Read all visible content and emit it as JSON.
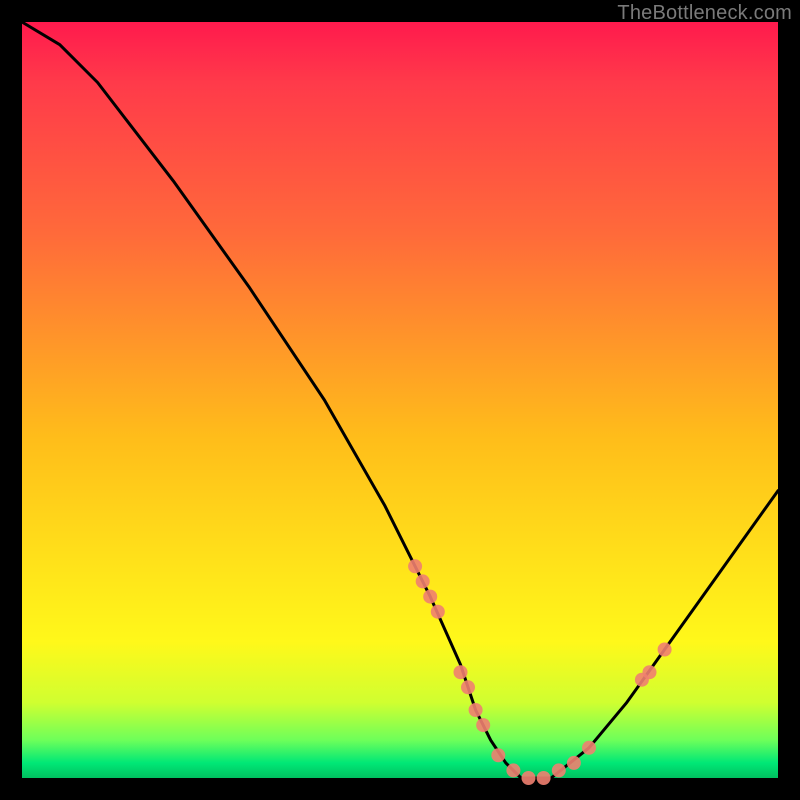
{
  "watermark": "TheBottleneck.com",
  "chart_data": {
    "type": "line",
    "title": "",
    "xlabel": "",
    "ylabel": "",
    "xlim": [
      0,
      100
    ],
    "ylim": [
      0,
      100
    ],
    "grid": false,
    "legend": false,
    "background_gradient": [
      "#ff1a4d",
      "#ffe31a",
      "#00c060"
    ],
    "series": [
      {
        "name": "bottleneck-curve",
        "color": "#000000",
        "x": [
          0,
          5,
          10,
          20,
          30,
          40,
          48,
          54,
          58,
          60,
          62,
          64,
          66,
          70,
          75,
          80,
          85,
          90,
          95,
          100
        ],
        "y": [
          100,
          97,
          92,
          79,
          65,
          50,
          36,
          24,
          15,
          9,
          5,
          2,
          0,
          0,
          4,
          10,
          17,
          24,
          31,
          38
        ]
      }
    ],
    "markers": [
      {
        "name": "marker-left-1",
        "x": 52,
        "y": 28,
        "color": "#f08070"
      },
      {
        "name": "marker-left-2",
        "x": 53,
        "y": 26,
        "color": "#f08070"
      },
      {
        "name": "marker-left-3",
        "x": 54,
        "y": 24,
        "color": "#f08070"
      },
      {
        "name": "marker-left-4",
        "x": 55,
        "y": 22,
        "color": "#f08070"
      },
      {
        "name": "marker-mid-1",
        "x": 58,
        "y": 14,
        "color": "#f08070"
      },
      {
        "name": "marker-mid-2",
        "x": 59,
        "y": 12,
        "color": "#f08070"
      },
      {
        "name": "marker-mid-3",
        "x": 60,
        "y": 9,
        "color": "#f08070"
      },
      {
        "name": "marker-mid-4",
        "x": 61,
        "y": 7,
        "color": "#f08070"
      },
      {
        "name": "marker-min-1",
        "x": 63,
        "y": 3,
        "color": "#f08070"
      },
      {
        "name": "marker-min-2",
        "x": 65,
        "y": 1,
        "color": "#f08070"
      },
      {
        "name": "marker-min-3",
        "x": 67,
        "y": 0,
        "color": "#f08070"
      },
      {
        "name": "marker-min-4",
        "x": 69,
        "y": 0,
        "color": "#f08070"
      },
      {
        "name": "marker-min-5",
        "x": 71,
        "y": 1,
        "color": "#f08070"
      },
      {
        "name": "marker-min-6",
        "x": 73,
        "y": 2,
        "color": "#f08070"
      },
      {
        "name": "marker-min-7",
        "x": 75,
        "y": 4,
        "color": "#f08070"
      },
      {
        "name": "marker-right-1",
        "x": 82,
        "y": 13,
        "color": "#f08070"
      },
      {
        "name": "marker-right-2",
        "x": 83,
        "y": 14,
        "color": "#f08070"
      },
      {
        "name": "marker-right-3",
        "x": 85,
        "y": 17,
        "color": "#f08070"
      }
    ]
  }
}
